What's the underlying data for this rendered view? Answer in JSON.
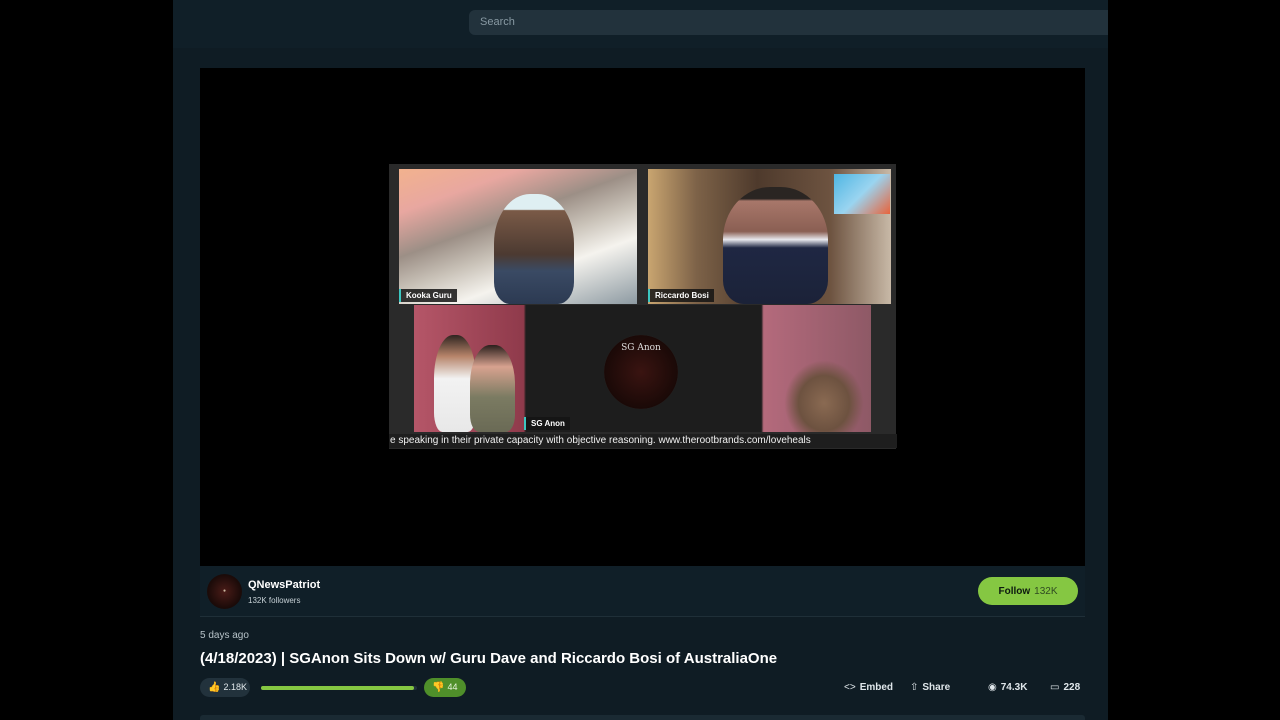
{
  "header": {
    "search_placeholder": "Search"
  },
  "video": {
    "participants": [
      {
        "name": "Kooka Guru"
      },
      {
        "name": "Riccardo Bosi"
      },
      {
        "name": "SG Anon"
      }
    ],
    "logo_text": "SG Anon",
    "ticker_text": "e speaking in their private capacity with objective reasoning. www.therootbrands.com/loveheals"
  },
  "channel": {
    "name": "QNewsPatriot",
    "followers": "132K followers",
    "follow_label": "Follow",
    "follow_count": "132K"
  },
  "post": {
    "posted": "5 days ago",
    "title": "(4/18/2023) | SGAnon Sits Down w/ Guru Dave and Riccardo Bosi of AustraliaOne"
  },
  "actions": {
    "likes": "2.18K",
    "dislikes": "44",
    "like_ratio": 0.98,
    "embed_label": "Embed",
    "share_label": "Share",
    "views": "74.3K",
    "comments": "228"
  },
  "colors": {
    "accent": "#85c742",
    "page_bg": "#0f1c24"
  },
  "icons": {
    "like": "thumbs-up-icon",
    "dislike": "thumbs-down-icon",
    "embed": "code-icon",
    "share": "share-icon",
    "views": "eye-icon",
    "comments": "comment-icon"
  }
}
